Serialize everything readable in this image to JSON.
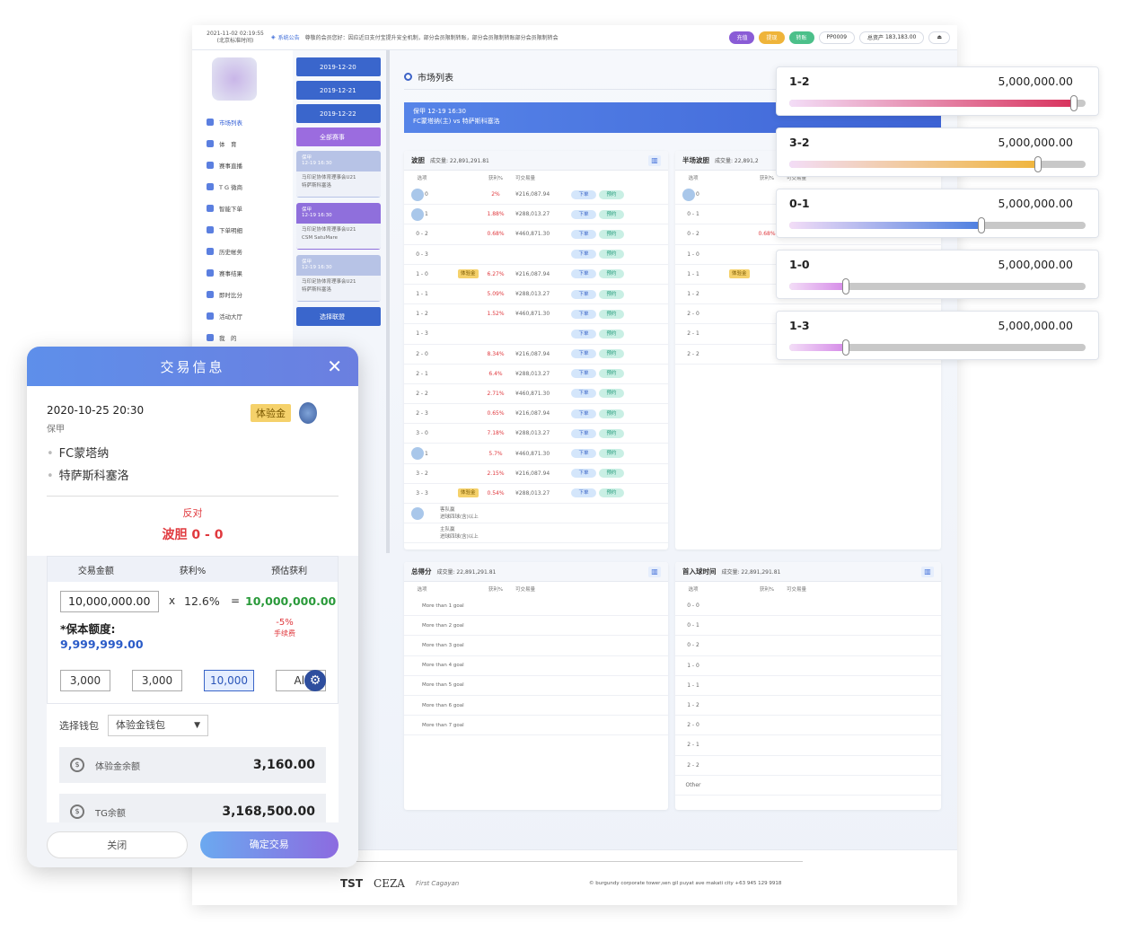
{
  "topbar": {
    "time": "2021-11-02 02:19:55",
    "tz": "(北京标准时间)",
    "notice_label": "系统公告",
    "notice": "尊敬的会员您好：因应近日支付宝提升安全机制，部分会员限制转账，部分会员限制转账部分会员限制转会",
    "deposit": "充值",
    "withdraw": "提现",
    "transfer": "转账",
    "user": "PP0009",
    "assets_label": "总资产",
    "assets": "183,183.00"
  },
  "sidebar": {
    "items": [
      {
        "label": "市场列表"
      },
      {
        "label": "体　育"
      },
      {
        "label": "赛事直播"
      },
      {
        "label": "T G 微商"
      },
      {
        "label": "智能下单"
      },
      {
        "label": "下单明细"
      },
      {
        "label": "历史帐务"
      },
      {
        "label": "赛事结果"
      },
      {
        "label": "即时比分"
      },
      {
        "label": "活动大厅"
      },
      {
        "label": "我　的"
      }
    ]
  },
  "dates": [
    "2019-12-20",
    "2019-12-21",
    "2019-12-22"
  ],
  "all_matches": "全部赛事",
  "select_league": "选择联盟",
  "match_cards": [
    {
      "league": "保甲",
      "time": "12-19 16:30",
      "t1": "马印足协体育理事会U21",
      "t2": "特萨斯科塞洛"
    },
    {
      "league": "保甲",
      "time": "12-19 16:30",
      "t1": "马印足协体育理事会U21",
      "t2": "CSM SatuMare"
    },
    {
      "league": "保甲",
      "time": "12-19 16:30",
      "t1": "马印足协体育理事会U21",
      "t2": "特萨斯科塞洛"
    }
  ],
  "main": {
    "title": "市场列表",
    "banner_line1": "保甲 12-19 16:30",
    "banner_line2": "FC蒙塔纳(主) vs 特萨斯科塞洛"
  },
  "panel_correct": {
    "title": "波胆",
    "vol": "成交量: 22,891,291.81",
    "headers": [
      "选项",
      "获利%",
      "可交易量"
    ],
    "order": "下单",
    "reserve": "预约",
    "rows": [
      {
        "opt": "0 - 0",
        "pct": "2%",
        "vol": "¥216,087.94"
      },
      {
        "opt": "0 - 1",
        "pct": "1.88%",
        "vol": "¥288,013.27"
      },
      {
        "opt": "0 - 2",
        "pct": "0.68%",
        "vol": "¥460,871.30"
      },
      {
        "opt": "0 - 3",
        "pct": "",
        "vol": ""
      },
      {
        "opt": "1 - 0",
        "pct": "6.27%",
        "vol": "¥216,087.94",
        "tag": "体验金"
      },
      {
        "opt": "1 - 1",
        "pct": "5.09%",
        "vol": "¥288,013.27"
      },
      {
        "opt": "1 - 2",
        "pct": "1.52%",
        "vol": "¥460,871.30"
      },
      {
        "opt": "1 - 3",
        "pct": "",
        "vol": ""
      },
      {
        "opt": "2 - 0",
        "pct": "8.34%",
        "vol": "¥216,087.94"
      },
      {
        "opt": "2 - 1",
        "pct": "6.4%",
        "vol": "¥288,013.27"
      },
      {
        "opt": "2 - 2",
        "pct": "2.71%",
        "vol": "¥460,871.30"
      },
      {
        "opt": "2 - 3",
        "pct": "0.65%",
        "vol": "¥216,087.94"
      },
      {
        "opt": "3 - 0",
        "pct": "7.18%",
        "vol": "¥288,013.27"
      },
      {
        "opt": "3 - 1",
        "pct": "5.7%",
        "vol": "¥460,871.30"
      },
      {
        "opt": "3 - 2",
        "pct": "2.15%",
        "vol": "¥216,087.94"
      },
      {
        "opt": "3 - 3",
        "pct": "0.54%",
        "vol": "¥288,013.27",
        "tag": "体验金"
      }
    ],
    "extra1": "客队赢",
    "extra1b": "进球四球(含)以上",
    "extra2": "主队赢",
    "extra2b": "进球四球(含)以上"
  },
  "panel_half": {
    "title": "半场波胆",
    "vol": "成交量: 22,891,2",
    "rows": [
      "0 - 0",
      "0 - 1",
      "0 - 2",
      "1 - 0",
      "1 - 1",
      "1 - 2",
      "2 - 0",
      "2 - 1",
      "2 - 2"
    ],
    "row2_pct": "0.68%",
    "row2_vol": "¥460,871.30"
  },
  "panel_goals": {
    "title": "总得分",
    "vol": "成交量: 22,891,291.81",
    "rows": [
      "More than 1 goal",
      "More than 2 goal",
      "More than 3 goal",
      "More than 4 goal",
      "More than 5 goal",
      "More than 6 goal",
      "More than 7 goal"
    ]
  },
  "panel_first": {
    "title": "首入球时间",
    "vol": "成交量: 22,891,291.81",
    "rows": [
      "0 - 0",
      "0 - 1",
      "0 - 2",
      "1 - 0",
      "1 - 1",
      "1 - 2",
      "2 - 0",
      "2 - 1",
      "2 - 2",
      "Other"
    ]
  },
  "footer": {
    "brand1": "TST",
    "brand2": "CEZA",
    "brand3": "First Cagayan",
    "addr": "© burgundy corporate tower,sen gil puyat ave makati city +63 945 129 9918"
  },
  "sliders": [
    {
      "label": "1-2",
      "amount": "5,000,000.00",
      "level": 0.96,
      "color": "#d8335d"
    },
    {
      "label": "3-2",
      "amount": "5,000,000.00",
      "level": 0.84,
      "color": "#f0b53c"
    },
    {
      "label": "0-1",
      "amount": "5,000,000.00",
      "level": 0.65,
      "color": "#4d7fe0"
    },
    {
      "label": "1-0",
      "amount": "5,000,000.00",
      "level": 0.19,
      "color": "#d58ae8"
    },
    {
      "label": "1-3",
      "amount": "5,000,000.00",
      "level": 0.19,
      "color": "#d58ae8"
    }
  ],
  "modal": {
    "title": "交易信息",
    "close_glyph": "✕",
    "date": "2020-10-25  20:30",
    "league": "保甲",
    "badge": "体验金",
    "team1": "FC蒙塔纳",
    "team2": "特萨斯科塞洛",
    "oppose": "反对",
    "bet": "波胆 0 - 0",
    "col1": "交易金额",
    "col2": "获利%",
    "col3": "预估获利",
    "amount": "10,000,000.00",
    "x": "x",
    "rate": "12.6%",
    "eq": "=",
    "result": "10,000,000.00",
    "ins_label": "*保本额度:",
    "ins_value": "9,999,999.00",
    "fee": "-5%",
    "fee_label": "手续费",
    "quick": [
      "3,000",
      "3,000",
      "10,000",
      "All"
    ],
    "wallet_label": "选择钱包",
    "wallet_value": "体验金钱包",
    "bal1_label": "体验金余额",
    "bal1": "3,160.00",
    "bal2_label": "TG余额",
    "bal2": "3,168,500.00",
    "cancel": "关闭",
    "confirm": "确定交易"
  }
}
